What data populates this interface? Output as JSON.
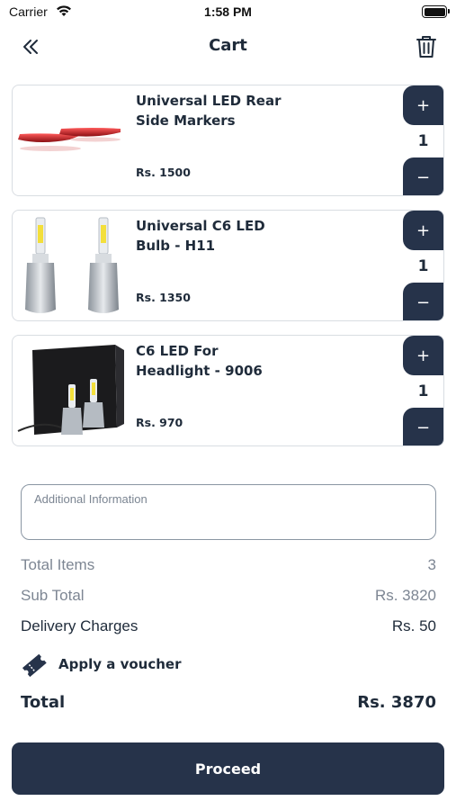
{
  "status_bar": {
    "carrier": "Carrier",
    "time": "1:58 PM"
  },
  "header": {
    "title": "Cart",
    "back_icon": "double-chevron-left-icon",
    "delete_icon": "trash-icon"
  },
  "items": [
    {
      "name": "Universal LED Rear Side Markers",
      "price": "Rs. 1500",
      "quantity": "1"
    },
    {
      "name": "Universal C6 LED Bulb - H11",
      "price": "Rs. 1350",
      "quantity": "1"
    },
    {
      "name": "C6 LED For Headlight - 9006",
      "price": "Rs. 970",
      "quantity": "1"
    }
  ],
  "qty_controls": {
    "plus": "+",
    "minus": "−"
  },
  "additional_info": {
    "placeholder": "Additional Information"
  },
  "summary": {
    "total_items_label": "Total Items",
    "total_items_value": "3",
    "sub_total_label": "Sub Total",
    "sub_total_value": "Rs. 3820",
    "delivery_label": "Delivery Charges",
    "delivery_value": "Rs. 50"
  },
  "voucher": {
    "label": "Apply a voucher",
    "icon": "ticket-icon"
  },
  "total": {
    "label": "Total",
    "value": "Rs. 3870"
  },
  "proceed": {
    "label": "Proceed"
  },
  "colors": {
    "primary": "#26334a",
    "text": "#1f2b3a",
    "muted": "#7d8693",
    "accent_red": "#d0242a"
  }
}
